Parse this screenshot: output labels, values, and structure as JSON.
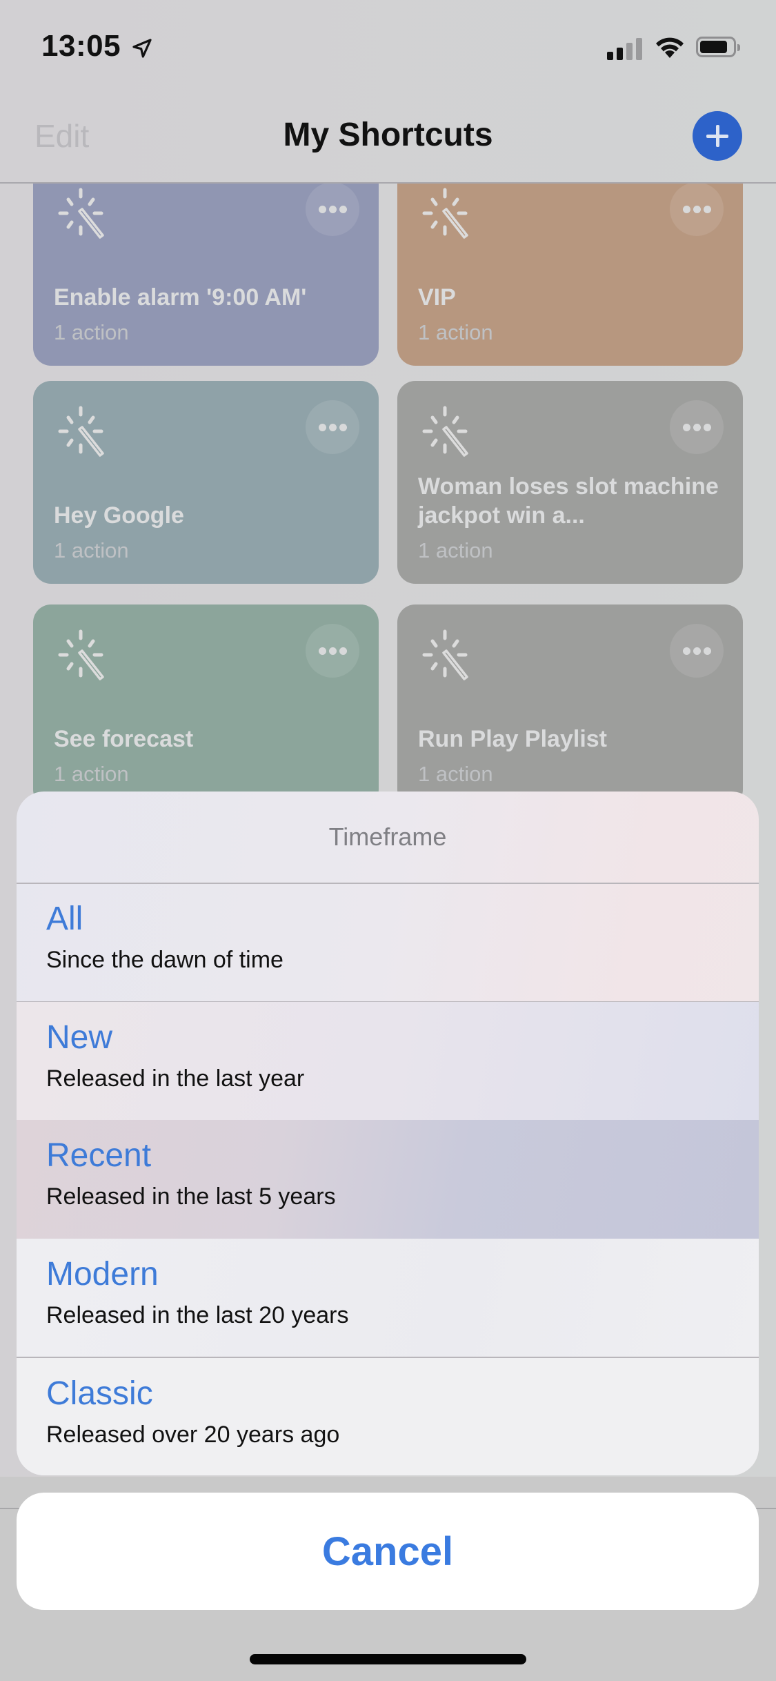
{
  "status_bar": {
    "time": "13:05",
    "location_icon": "location-arrow-icon",
    "signal_bars_active": 2,
    "signal_bars_total": 4,
    "wifi_icon": "wifi-icon",
    "battery_level": 0.85
  },
  "nav": {
    "edit_label": "Edit",
    "title": "My Shortcuts",
    "add_icon": "plus-icon"
  },
  "shortcuts": [
    {
      "title": "Enable alarm '9:00 AM'",
      "subtitle": "1 action",
      "color": "#9096b2",
      "icon": "magic-wand-icon"
    },
    {
      "title": "VIP",
      "subtitle": "1 action",
      "color": "#b7977f",
      "icon": "magic-wand-icon"
    },
    {
      "title": "Hey Google",
      "subtitle": "1 action",
      "color": "#8fa2a8",
      "icon": "magic-wand-icon"
    },
    {
      "title": "Woman loses slot machine jackpot win a...",
      "subtitle": "1 action",
      "color": "#9d9e9c",
      "icon": "magic-wand-icon"
    },
    {
      "title": "See forecast",
      "subtitle": "1 action",
      "color": "#8ca59b",
      "icon": "magic-wand-icon"
    },
    {
      "title": "Run Play Playlist",
      "subtitle": "1 action",
      "color": "#9d9e9c",
      "icon": "magic-wand-icon"
    }
  ],
  "action_sheet": {
    "title": "Timeframe",
    "options": [
      {
        "label": "All",
        "description": "Since the dawn of time",
        "highlighted": false
      },
      {
        "label": "New",
        "description": "Released in the last year",
        "highlighted": false
      },
      {
        "label": "Recent",
        "description": "Released in the last 5 years",
        "highlighted": true
      },
      {
        "label": "Modern",
        "description": "Released in the last 20 years",
        "highlighted": false
      },
      {
        "label": "Classic",
        "description": "Released over 20 years ago",
        "highlighted": false
      }
    ],
    "cancel_label": "Cancel"
  },
  "colors": {
    "accent": "#3a7be0",
    "add_button": "#2d62c9"
  }
}
